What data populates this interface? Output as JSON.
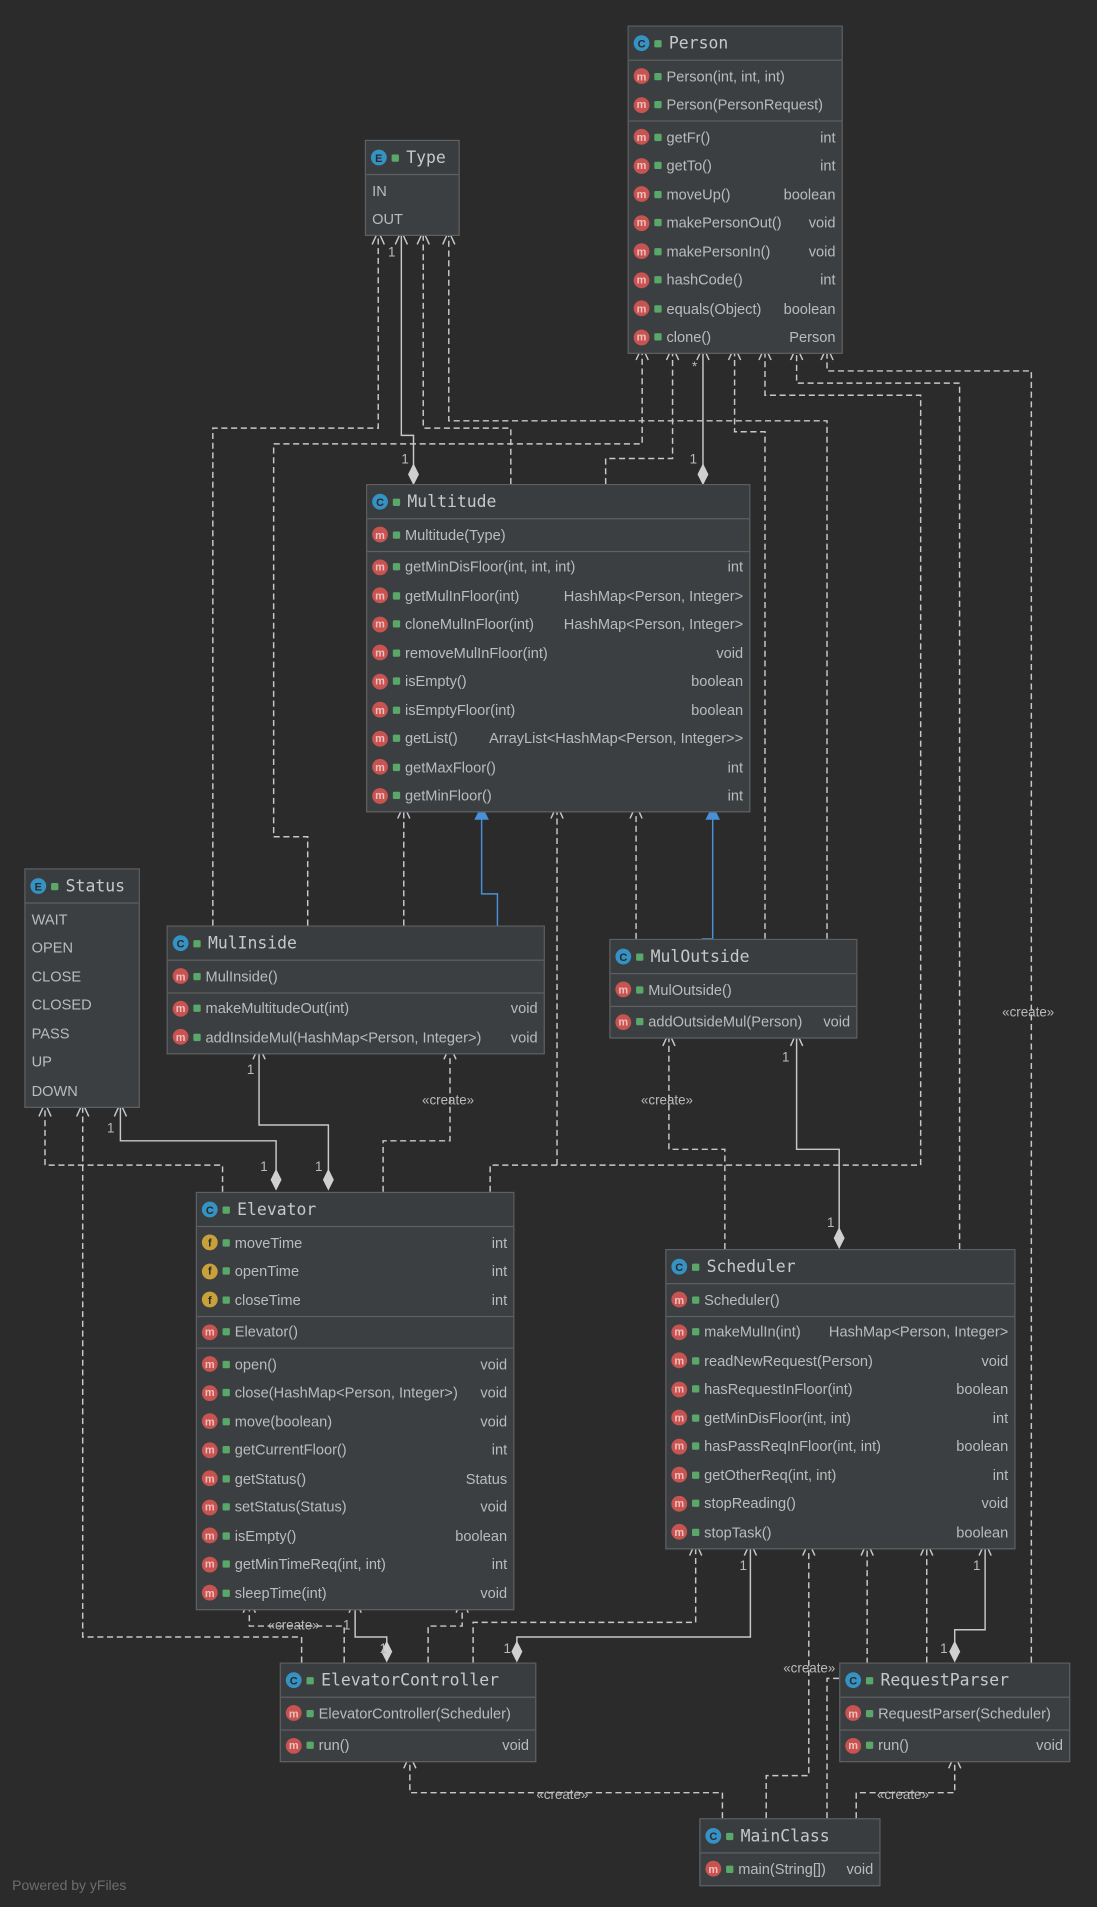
{
  "classes": [
    {
      "id": "person",
      "kind": "C",
      "name": "Person",
      "sections": [
        [
          {
            "i": "m",
            "n": "Person(int, int, int)",
            "t": ""
          },
          {
            "i": "m",
            "n": "Person(PersonRequest)",
            "t": ""
          }
        ],
        [
          {
            "i": "m",
            "n": "getFr()",
            "t": "int"
          },
          {
            "i": "m",
            "n": "getTo()",
            "t": "int"
          },
          {
            "i": "m",
            "n": "moveUp()",
            "t": "boolean"
          },
          {
            "i": "m",
            "n": "makePersonOut()",
            "t": "void"
          },
          {
            "i": "m",
            "n": "makePersonIn()",
            "t": "void"
          },
          {
            "i": "m",
            "n": "hashCode()",
            "t": "int"
          },
          {
            "i": "m",
            "n": "equals(Object)",
            "t": "boolean"
          },
          {
            "i": "m",
            "n": "clone()",
            "t": "Person"
          }
        ]
      ]
    },
    {
      "id": "type",
      "kind": "E",
      "name": "Type",
      "sections": [
        [
          {
            "i": "",
            "n": "IN",
            "t": ""
          },
          {
            "i": "",
            "n": "OUT",
            "t": ""
          }
        ]
      ]
    },
    {
      "id": "multitude",
      "kind": "C",
      "name": "Multitude",
      "sections": [
        [
          {
            "i": "m",
            "n": "Multitude(Type)",
            "t": ""
          }
        ],
        [
          {
            "i": "m",
            "n": "getMinDisFloor(int, int, int)",
            "t": "int"
          },
          {
            "i": "m",
            "n": "getMulInFloor(int)",
            "t": "HashMap<Person, Integer>"
          },
          {
            "i": "m",
            "n": "cloneMulInFloor(int)",
            "t": "HashMap<Person, Integer>"
          },
          {
            "i": "m",
            "n": "removeMulInFloor(int)",
            "t": "void"
          },
          {
            "i": "m",
            "n": "isEmpty()",
            "t": "boolean"
          },
          {
            "i": "m",
            "n": "isEmptyFloor(int)",
            "t": "boolean"
          },
          {
            "i": "m",
            "n": "getList()",
            "t": "ArrayList<HashMap<Person, Integer>>"
          },
          {
            "i": "m",
            "n": "getMaxFloor()",
            "t": "int"
          },
          {
            "i": "m",
            "n": "getMinFloor()",
            "t": "int"
          }
        ]
      ]
    },
    {
      "id": "status",
      "kind": "E",
      "name": "Status",
      "sections": [
        [
          {
            "i": "",
            "n": "WAIT",
            "t": ""
          },
          {
            "i": "",
            "n": "OPEN",
            "t": ""
          },
          {
            "i": "",
            "n": "CLOSE",
            "t": ""
          },
          {
            "i": "",
            "n": "CLOSED",
            "t": ""
          },
          {
            "i": "",
            "n": "PASS",
            "t": ""
          },
          {
            "i": "",
            "n": "UP",
            "t": ""
          },
          {
            "i": "",
            "n": "DOWN",
            "t": ""
          }
        ]
      ]
    },
    {
      "id": "mulinside",
      "kind": "C",
      "name": "MulInside",
      "sections": [
        [
          {
            "i": "m",
            "n": "MulInside()",
            "t": ""
          }
        ],
        [
          {
            "i": "m",
            "n": "makeMultitudeOut(int)",
            "t": "void"
          },
          {
            "i": "m",
            "n": "addInsideMul(HashMap<Person, Integer>)",
            "t": "void"
          }
        ]
      ]
    },
    {
      "id": "muloutside",
      "kind": "C",
      "name": "MulOutside",
      "sections": [
        [
          {
            "i": "m",
            "n": "MulOutside()",
            "t": ""
          }
        ],
        [
          {
            "i": "m",
            "n": "addOutsideMul(Person)",
            "t": "void"
          }
        ]
      ]
    },
    {
      "id": "elevator",
      "kind": "C",
      "name": "Elevator",
      "sections": [
        [
          {
            "i": "f",
            "n": "moveTime",
            "t": "int"
          },
          {
            "i": "f",
            "n": "openTime",
            "t": "int"
          },
          {
            "i": "f",
            "n": "closeTime",
            "t": "int"
          }
        ],
        [
          {
            "i": "m",
            "n": "Elevator()",
            "t": ""
          }
        ],
        [
          {
            "i": "m",
            "n": "open()",
            "t": "void"
          },
          {
            "i": "m",
            "n": "close(HashMap<Person, Integer>)",
            "t": "void"
          },
          {
            "i": "m",
            "n": "move(boolean)",
            "t": "void"
          },
          {
            "i": "m",
            "n": "getCurrentFloor()",
            "t": "int"
          },
          {
            "i": "m",
            "n": "getStatus()",
            "t": "Status"
          },
          {
            "i": "m",
            "n": "setStatus(Status)",
            "t": "void"
          },
          {
            "i": "m",
            "n": "isEmpty()",
            "t": "boolean"
          },
          {
            "i": "m",
            "n": "getMinTimeReq(int, int)",
            "t": "int"
          },
          {
            "i": "m",
            "n": "sleepTime(int)",
            "t": "void"
          }
        ]
      ]
    },
    {
      "id": "scheduler",
      "kind": "C",
      "name": "Scheduler",
      "sections": [
        [
          {
            "i": "m",
            "n": "Scheduler()",
            "t": ""
          }
        ],
        [
          {
            "i": "m",
            "n": "makeMulIn(int)",
            "t": "HashMap<Person, Integer>"
          },
          {
            "i": "m",
            "n": "readNewRequest(Person)",
            "t": "void"
          },
          {
            "i": "m",
            "n": "hasRequestInFloor(int)",
            "t": "boolean"
          },
          {
            "i": "m",
            "n": "getMinDisFloor(int, int)",
            "t": "int"
          },
          {
            "i": "m",
            "n": "hasPassReqInFloor(int, int)",
            "t": "boolean"
          },
          {
            "i": "m",
            "n": "getOtherReq(int, int)",
            "t": "int"
          },
          {
            "i": "m",
            "n": "stopReading()",
            "t": "void"
          },
          {
            "i": "m",
            "n": "stopTask()",
            "t": "boolean"
          }
        ]
      ]
    },
    {
      "id": "elevatorcontroller",
      "kind": "C",
      "name": "ElevatorController",
      "sections": [
        [
          {
            "i": "m",
            "n": "ElevatorController(Scheduler)",
            "t": ""
          }
        ],
        [
          {
            "i": "m",
            "n": "run()",
            "t": "void"
          }
        ]
      ]
    },
    {
      "id": "requestparser",
      "kind": "C",
      "name": "RequestParser",
      "sections": [
        [
          {
            "i": "m",
            "n": "RequestParser(Scheduler)",
            "t": ""
          }
        ],
        [
          {
            "i": "m",
            "n": "run()",
            "t": "void"
          }
        ]
      ]
    },
    {
      "id": "mainclass",
      "kind": "C",
      "name": "MainClass",
      "sections": [
        [
          {
            "i": "m",
            "n": "main(String[])",
            "t": "void"
          }
        ]
      ]
    }
  ],
  "edge_labels": {
    "one": "1",
    "many": "*",
    "create": "«create»"
  },
  "footer": "Powered by yFiles",
  "colors": {
    "background": "#2b2b2b",
    "box": "#3c3f41",
    "edge": "#c8c8c8",
    "inheritance": "#4a90d9"
  }
}
